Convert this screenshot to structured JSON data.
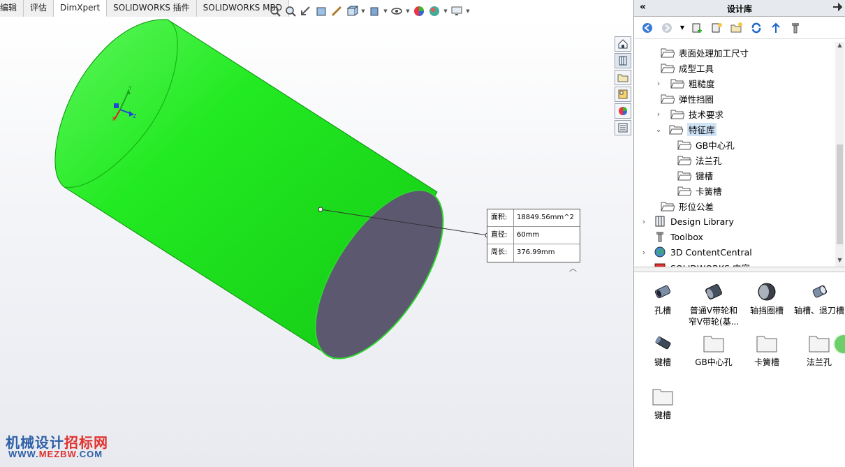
{
  "tabs": [
    "编辑",
    "评估",
    "DimXpert",
    "SOLIDWORKS 插件",
    "SOLIDWORKS MBD"
  ],
  "hud_icons": [
    "zoom-to-fit-icon",
    "zoom-area-icon",
    "previous-view-icon",
    "section-view-icon",
    "dynamic-annotation-icon",
    "view-orientation-icon",
    "display-style-icon",
    "hide-show-icon",
    "edit-appearance-icon",
    "apply-scene-icon",
    "view-settings-icon"
  ],
  "measure": {
    "area_label": "面积:",
    "area_value": "18849.56mm^2",
    "diameter_label": "直径:",
    "diameter_value": "60mm",
    "perimeter_label": "周长:",
    "perimeter_value": "376.99mm"
  },
  "triad": {
    "x": "X",
    "y": "Y",
    "z": "Z"
  },
  "watermark": {
    "line1a": "机械设计",
    "line1b": "招标网",
    "line2a": "WWW.",
    "line2b": "MEZBW",
    "line2c": ".COM"
  },
  "pane": {
    "title": "设计库",
    "tree": [
      {
        "label": "表面处理加工尺寸",
        "indent": 1,
        "exp": ""
      },
      {
        "label": "成型工具",
        "indent": 1,
        "exp": ""
      },
      {
        "label": "粗糙度",
        "indent": 1,
        "exp": ">"
      },
      {
        "label": "弹性挡圈",
        "indent": 1,
        "exp": ""
      },
      {
        "label": "技术要求",
        "indent": 1,
        "exp": ">"
      },
      {
        "label": "特征库",
        "indent": 1,
        "exp": "v",
        "selected": true
      },
      {
        "label": "GB中心孔",
        "indent": 2,
        "exp": ""
      },
      {
        "label": "法兰孔",
        "indent": 2,
        "exp": ""
      },
      {
        "label": "键槽",
        "indent": 2,
        "exp": ""
      },
      {
        "label": "卡簧槽",
        "indent": 2,
        "exp": ""
      },
      {
        "label": "形位公差",
        "indent": 1,
        "exp": ""
      },
      {
        "label": "Design Library",
        "indent": 0,
        "exp": ">"
      },
      {
        "label": "Toolbox",
        "indent": 0,
        "exp": ""
      },
      {
        "label": "3D ContentCentral",
        "indent": 0,
        "exp": ">"
      },
      {
        "label": "SOLIDWORKS 内容",
        "indent": 0,
        "exp": ">"
      }
    ],
    "items": [
      {
        "label": "孔槽",
        "icon": "hole-slot-icon"
      },
      {
        "label": "普通V带轮和窄V带轮(基...",
        "icon": "v-pulley-icon"
      },
      {
        "label": "轴挡圈槽",
        "icon": "shaft-ring-groove-icon"
      },
      {
        "label": "轴槽、退刀槽",
        "icon": "shaft-groove-icon"
      },
      {
        "label": "键槽",
        "icon": "keyway-icon"
      },
      {
        "label": "GB中心孔",
        "icon": "folder-icon"
      },
      {
        "label": "卡簧槽",
        "icon": "folder-icon"
      },
      {
        "label": "法兰孔",
        "icon": "folder-icon"
      },
      {
        "label": "键槽",
        "icon": "folder-icon"
      }
    ]
  },
  "colors": {
    "cylinder": "#1ee81e",
    "face": "#5c5870",
    "accent": "#2d5fa6"
  }
}
